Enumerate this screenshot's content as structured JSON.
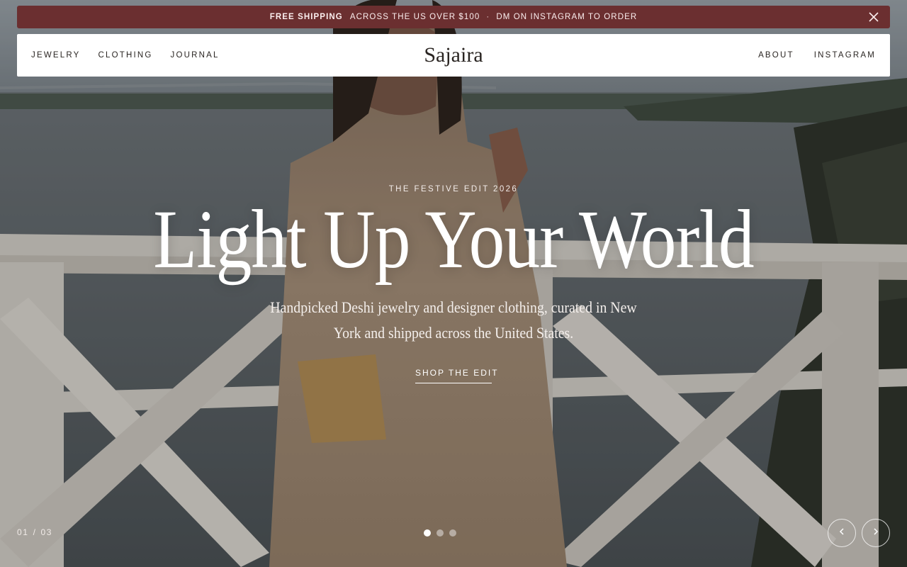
{
  "announcement": {
    "bold": "Free Shipping",
    "text": "Across the US over $100",
    "separator": "·",
    "order_text": "DM on Instagram to order"
  },
  "nav": {
    "left": [
      "Jewelry",
      "Clothing",
      "Journal"
    ],
    "logo": "Sajaira",
    "right": [
      "About",
      "Instagram"
    ]
  },
  "hero": {
    "eyebrow": "The Festive Edit 2026",
    "headline": "Light Up Your World",
    "subline": "Handpicked Deshi jewelry and designer clothing, curated in New York and shipped across the United States.",
    "cta": "Shop the Edit"
  },
  "slider": {
    "current": "01",
    "separator": "/",
    "total": "03",
    "dot_count": 3,
    "active_index": 0
  },
  "colors": {
    "announcement_bg": "#6b2f30",
    "nav_bg": "#ffffff",
    "text_dark": "#2a2522"
  },
  "icons": {
    "close": "close-icon",
    "prev": "chevron-left-icon",
    "next": "chevron-right-icon"
  }
}
